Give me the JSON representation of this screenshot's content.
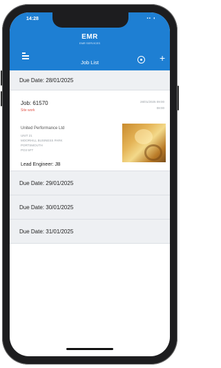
{
  "status": {
    "time": "14:28",
    "icons": "▪▪ ◖"
  },
  "header": {
    "logo": "EMR",
    "logo_sub": "EMR SERVICES",
    "title": "Job List"
  },
  "date_groups": [
    {
      "label": "Due Date: 28/01/2025"
    },
    {
      "label": "Due Date: 29/01/2025"
    },
    {
      "label": "Due Date: 30/01/2025"
    },
    {
      "label": "Due Date: 31/01/2025"
    }
  ],
  "job": {
    "number": "Job: 61570",
    "status": "Site work",
    "meta_line1": "28/01/2025 09:00",
    "meta_line2": "08:00",
    "company": "United Performance Ltd",
    "address_lines": [
      "UNIT 21",
      "MOORHILL BUSINESS PARK",
      "PORTSMOUTH",
      "PO3 5FT"
    ],
    "lead_engineer": "Lead Engineer: JB"
  },
  "icons": {
    "menu": "menu-icon",
    "filter": "filter-icon",
    "add": "add-icon"
  },
  "colors": {
    "accent": "#1e7fd3",
    "status": "#e2574c",
    "section_bg": "#eef0f3"
  }
}
